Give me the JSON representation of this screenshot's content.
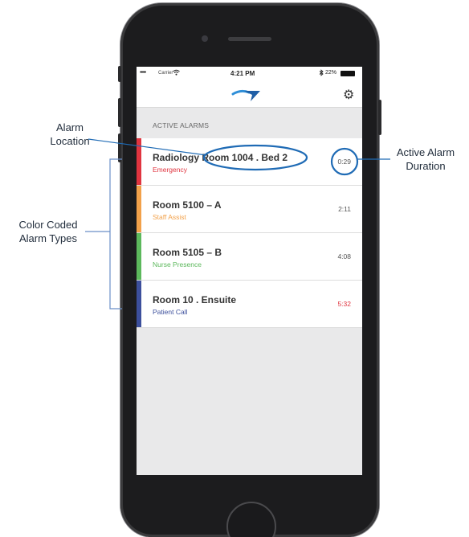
{
  "status_bar": {
    "signal": "•••••",
    "carrier": "Carrier",
    "wifi_icon": "wifi-icon",
    "time": "4:21 PM",
    "bluetooth_icon": "bluetooth-icon",
    "battery": "22%"
  },
  "nav": {
    "logo_icon": "app-logo-icon",
    "settings_icon": "gear-icon"
  },
  "section_header": "ACTIVE ALARMS",
  "alarms": [
    {
      "location": "Radiology  Room 1004 . Bed 2",
      "type": "Emergency",
      "duration": "0:29",
      "color": "#e0343f",
      "duration_color": "#555555"
    },
    {
      "location": "Room 5100 – A",
      "type": "Staff Assist",
      "duration": "2:11",
      "color": "#f2a14a",
      "duration_color": "#555555"
    },
    {
      "location": "Room 5105 – B",
      "type": "Nurse Presence",
      "duration": "4:08",
      "color": "#5cb85c",
      "duration_color": "#555555"
    },
    {
      "location": "Room 10 . Ensuite",
      "type": "Patient Call",
      "duration": "5:32",
      "color": "#3c4f9c",
      "duration_color": "#e0343f"
    }
  ],
  "annotations": {
    "alarm_location": {
      "line1": "Alarm",
      "line2": "Location"
    },
    "active_alarm_duration": {
      "line1": "Active Alarm",
      "line2": "Duration"
    },
    "color_coded": {
      "line1": "Color Coded",
      "line2": "Alarm Types"
    }
  },
  "colors": {
    "annotation_blue": "#1f6bb5",
    "phone_body": "#1c1c1e",
    "screen_bg": "#e9e9ea"
  }
}
